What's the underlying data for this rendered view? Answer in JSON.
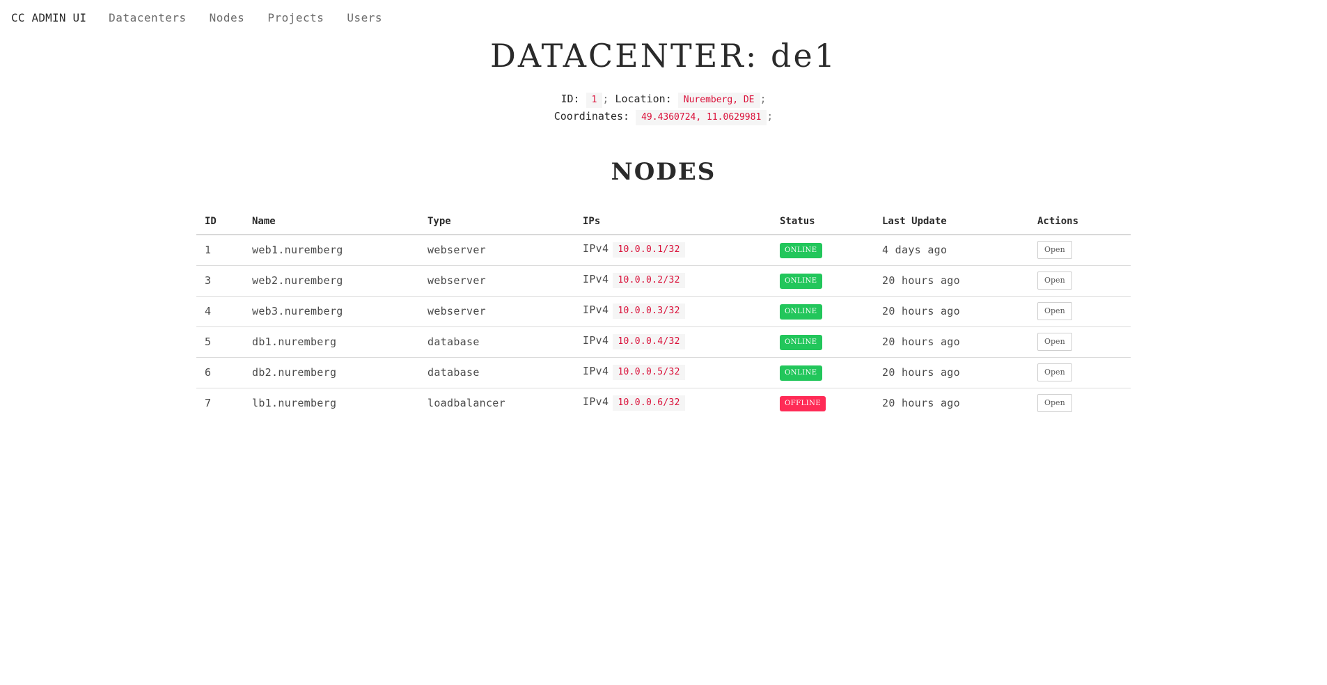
{
  "nav": {
    "brand": "CC ADMIN UI",
    "links": [
      "Datacenters",
      "Nodes",
      "Projects",
      "Users"
    ]
  },
  "page": {
    "title": "DATACENTER: de1"
  },
  "datacenter": {
    "id_label": "ID:",
    "id": "1",
    "location_label": "Location:",
    "location": "Nuremberg, DE",
    "coordinates_label": "Coordinates:",
    "coordinates": "49.4360724, 11.0629981",
    "separator": ";"
  },
  "nodes_section": {
    "title": "NODES",
    "columns": [
      "ID",
      "Name",
      "Type",
      "IPs",
      "Status",
      "Last Update",
      "Actions"
    ],
    "rows": [
      {
        "id": "1",
        "name": "web1.nuremberg",
        "type": "webserver",
        "ip_family": "IPv4",
        "ip": "10.0.0.1/32",
        "status": "ONLINE",
        "last_update": "4 days ago",
        "action": "Open"
      },
      {
        "id": "3",
        "name": "web2.nuremberg",
        "type": "webserver",
        "ip_family": "IPv4",
        "ip": "10.0.0.2/32",
        "status": "ONLINE",
        "last_update": "20 hours ago",
        "action": "Open"
      },
      {
        "id": "4",
        "name": "web3.nuremberg",
        "type": "webserver",
        "ip_family": "IPv4",
        "ip": "10.0.0.3/32",
        "status": "ONLINE",
        "last_update": "20 hours ago",
        "action": "Open"
      },
      {
        "id": "5",
        "name": "db1.nuremberg",
        "type": "database",
        "ip_family": "IPv4",
        "ip": "10.0.0.4/32",
        "status": "ONLINE",
        "last_update": "20 hours ago",
        "action": "Open"
      },
      {
        "id": "6",
        "name": "db2.nuremberg",
        "type": "database",
        "ip_family": "IPv4",
        "ip": "10.0.0.5/32",
        "status": "ONLINE",
        "last_update": "20 hours ago",
        "action": "Open"
      },
      {
        "id": "7",
        "name": "lb1.nuremberg",
        "type": "loadbalancer",
        "ip_family": "IPv4",
        "ip": "10.0.0.6/32",
        "status": "OFFLINE",
        "last_update": "20 hours ago",
        "action": "Open"
      }
    ]
  },
  "colors": {
    "online": "#22c65b",
    "offline": "#ff2b56",
    "code_text": "#da1039",
    "code_bg": "#f5f5f5"
  }
}
